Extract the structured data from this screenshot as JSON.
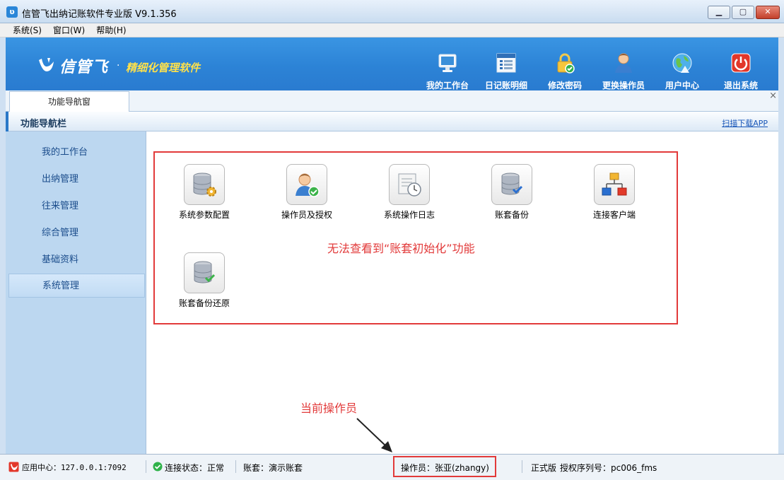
{
  "window": {
    "title": "信管飞出纳记账软件专业版 V9.1.356",
    "minimize": "▁",
    "maximize": "▢",
    "close": "✕"
  },
  "menu": [
    "系统(S)",
    "窗口(W)",
    "帮助(H)"
  ],
  "banner": {
    "brand": "信管飞",
    "dot": "·",
    "slogan": "精细化管理软件"
  },
  "toolbar": [
    {
      "label": "我的工作台",
      "icon": "monitor-icon"
    },
    {
      "label": "日记账明细",
      "icon": "ledger-icon"
    },
    {
      "label": "修改密码",
      "icon": "lock-icon"
    },
    {
      "label": "更换操作员",
      "icon": "user-icon"
    },
    {
      "label": "用户中心",
      "icon": "globe-icon"
    },
    {
      "label": "退出系统",
      "icon": "power-icon"
    }
  ],
  "tabs": [
    {
      "label": "功能导航窗"
    }
  ],
  "tab_close": "×",
  "navbar": {
    "title": "功能导航栏",
    "app_link": "扫描下载APP"
  },
  "sidebar": [
    "我的工作台",
    "出纳管理",
    "往来管理",
    "综合管理",
    "基础资料",
    "系统管理"
  ],
  "sidebar_active": "系统管理",
  "functions": [
    {
      "label": "系统参数配置",
      "icon": "database-gear-icon"
    },
    {
      "label": "操作员及授权",
      "icon": "user-check-icon"
    },
    {
      "label": "系统操作日志",
      "icon": "log-clock-icon"
    },
    {
      "label": "账套备份",
      "icon": "database-backup-icon"
    },
    {
      "label": "连接客户端",
      "icon": "network-icon"
    },
    {
      "label": "账套备份还原",
      "icon": "database-restore-icon"
    }
  ],
  "annotations": {
    "missing_feature": "无法查看到“账套初始化”功能",
    "current_operator": "当前操作员"
  },
  "status": {
    "app_center": "应用中心：127.0.0.1:7092",
    "connection": "连接状态：正常",
    "account_set": "账套：演示账套",
    "operator": "操作员：张亚(zhangy)",
    "edition": "正式版",
    "license": "授权序列号：pc006_fms"
  }
}
